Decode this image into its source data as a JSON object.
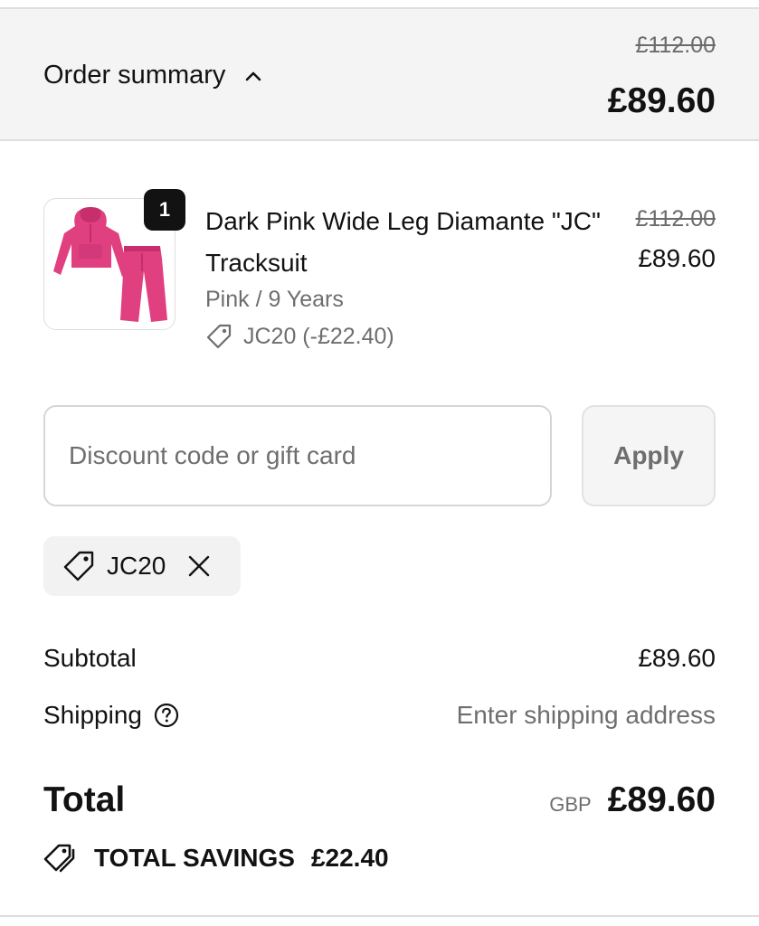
{
  "summary": {
    "toggle_label": "Order summary",
    "original_total": "£112.00",
    "total": "£89.60"
  },
  "item": {
    "quantity": "1",
    "title": "Dark Pink Wide Leg Diamante \"JC\" Tracksuit",
    "variant": "Pink / 9 Years",
    "discount": "JC20 (-£22.40)",
    "original_price": "£112.00",
    "price": "£89.60",
    "image_icon": "tracksuit-product-image"
  },
  "discount_form": {
    "placeholder": "Discount code or gift card",
    "apply_label": "Apply"
  },
  "applied_code": {
    "code": "JC20"
  },
  "totals": {
    "subtotal_label": "Subtotal",
    "subtotal_value": "£89.60",
    "shipping_label": "Shipping",
    "shipping_value": "Enter shipping address",
    "total_label": "Total",
    "currency": "GBP",
    "total_value": "£89.60",
    "savings_label": "TOTAL SAVINGS",
    "savings_value": "£22.40"
  },
  "colors": {
    "text": "#121212",
    "muted": "#6e6e6e",
    "summary_bg": "#f4f4f4",
    "product_pink": "#e0407f"
  }
}
